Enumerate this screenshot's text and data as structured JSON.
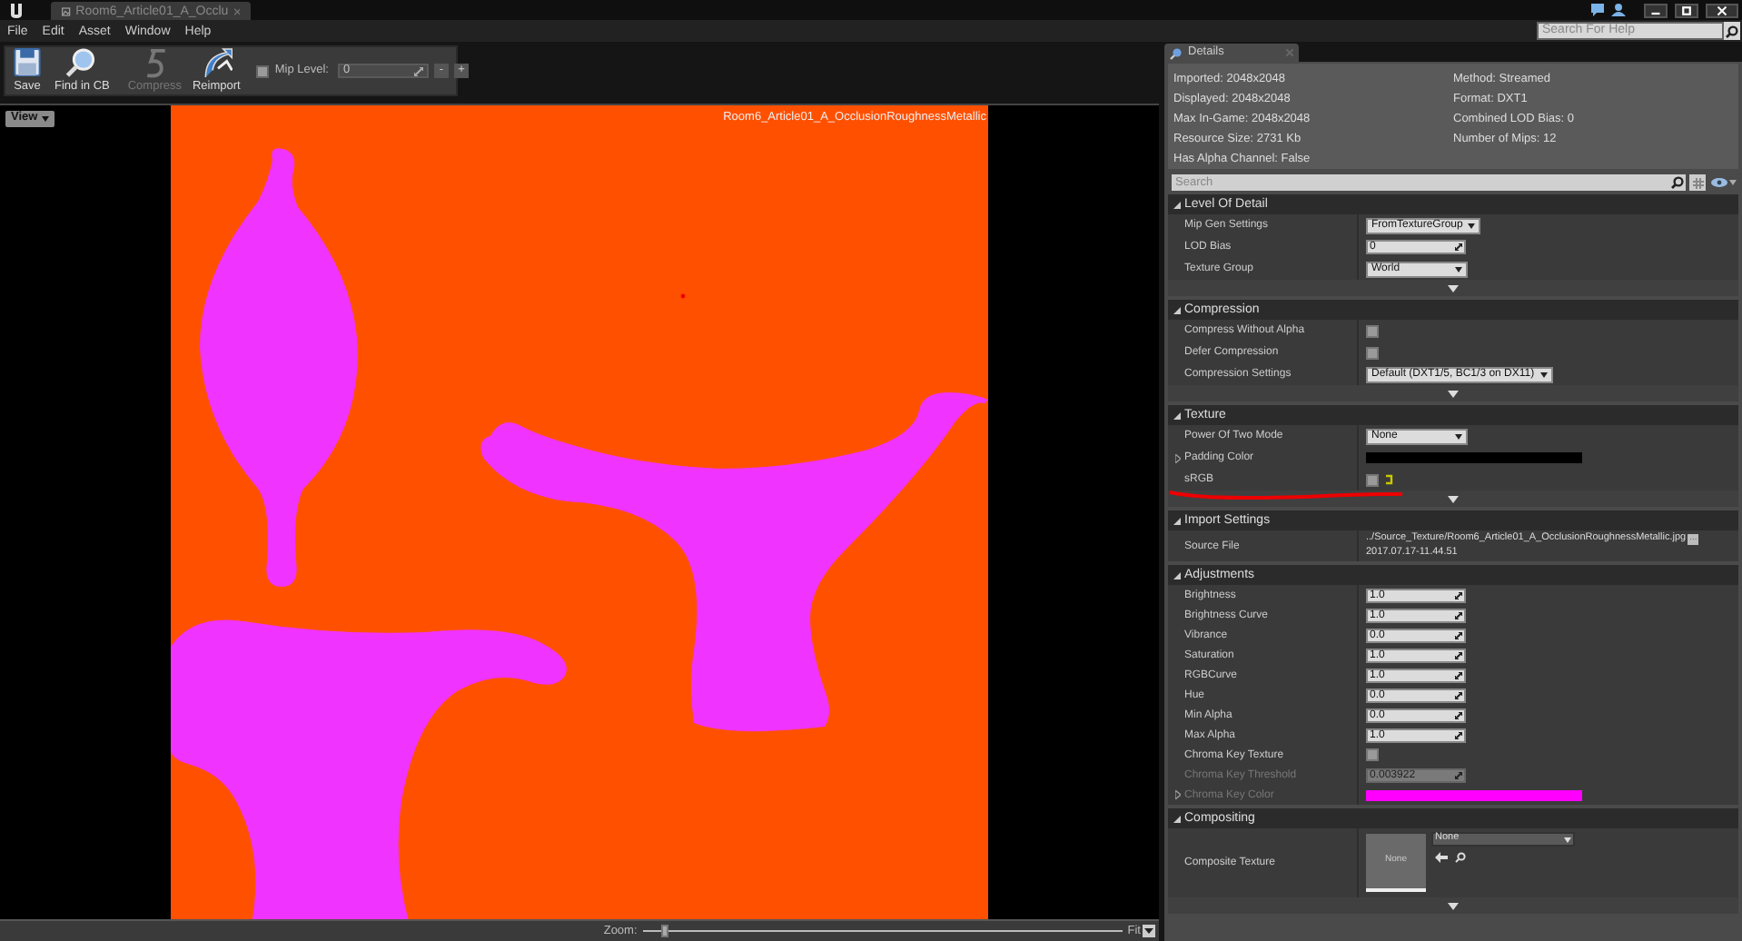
{
  "window": {
    "tab": {
      "title": "Room6_Article01_A_Occlu",
      "selected": true
    }
  },
  "menu": [
    "File",
    "Edit",
    "Asset",
    "Window",
    "Help"
  ],
  "toolbar": {
    "buttons": [
      {
        "label": "Save",
        "kind": "save",
        "disabled": false
      },
      {
        "label": "Find in CB",
        "kind": "find",
        "disabled": false
      },
      {
        "label": "Compress",
        "kind": "compress",
        "disabled": true
      },
      {
        "label": "Reimport",
        "kind": "reimport",
        "disabled": false
      }
    ],
    "mip_level": {
      "label": "Mip Level:",
      "checked": false,
      "value": "0",
      "minus": "-",
      "plus": "+"
    }
  },
  "viewport": {
    "view_button": "View",
    "texture_name": "Room6_Article01_A_OcclusionRoughnessMetallic",
    "zoom": {
      "label": "Zoom:",
      "level": 0.04,
      "fit": "Fit"
    }
  },
  "help_search": {
    "placeholder": "Search For Help"
  },
  "details": {
    "tab": "Details",
    "info_left": [
      "Imported: 2048x2048",
      "Displayed: 2048x2048",
      "Max In-Game: 2048x2048",
      "Resource Size: 2731 Kb",
      "Has Alpha Channel: False"
    ],
    "info_right": [
      "Method: Streamed",
      "Format: DXT1",
      "Combined LOD Bias: 0",
      "Number of Mips: 12"
    ],
    "search": {
      "placeholder": "Search"
    },
    "sections": [
      {
        "title": "Level Of Detail",
        "expanded": true,
        "advanced_toggle": true,
        "rows": [
          {
            "label": "Mip Gen Settings",
            "kind": "dropdown",
            "value": "FromTextureGroup",
            "disabled": false
          },
          {
            "label": "LOD Bias",
            "kind": "number",
            "value": "0",
            "disabled": false
          },
          {
            "label": "Texture Group",
            "kind": "dropdown",
            "value": "World",
            "disabled": false
          }
        ]
      },
      {
        "title": "Compression",
        "expanded": true,
        "advanced_toggle": true,
        "rows": [
          {
            "label": "Compress Without Alpha",
            "kind": "checkbox",
            "checked": false,
            "modified": false,
            "disabled": false
          },
          {
            "label": "Defer Compression",
            "kind": "checkbox",
            "checked": false,
            "modified": false,
            "disabled": false
          },
          {
            "label": "Compression Settings",
            "kind": "dropdown",
            "value": "Default (DXT1/5, BC1/3 on DX11)",
            "disabled": false
          }
        ]
      },
      {
        "title": "Texture",
        "expanded": true,
        "advanced_toggle": true,
        "rows": [
          {
            "label": "Power Of Two Mode",
            "kind": "dropdown",
            "value": "None",
            "disabled": false
          },
          {
            "label": "Padding Color",
            "kind": "color",
            "color": "#000000",
            "disabled": false
          },
          {
            "label": "sRGB",
            "kind": "checkbox",
            "checked": false,
            "modified": true,
            "disabled": false,
            "underlined": true
          }
        ]
      },
      {
        "title": "Import Settings",
        "expanded": true,
        "advanced_toggle": false,
        "rows": [
          {
            "label": "Source File",
            "kind": "file",
            "value": "../Source_Texture/Room6_Article01_A_OcclusionRoughnessMetallic.jpg",
            "date": "2017.07.17-11.44.51",
            "browse": "...",
            "disabled": false
          }
        ]
      },
      {
        "title": "Adjustments",
        "expanded": true,
        "advanced_toggle": false,
        "rows": [
          {
            "label": "Brightness",
            "kind": "number",
            "value": "1.0",
            "disabled": false
          },
          {
            "label": "Brightness Curve",
            "kind": "number",
            "value": "1.0",
            "disabled": false
          },
          {
            "label": "Vibrance",
            "kind": "number",
            "value": "0.0",
            "disabled": false
          },
          {
            "label": "Saturation",
            "kind": "number",
            "value": "1.0",
            "disabled": false
          },
          {
            "label": "RGBCurve",
            "kind": "number",
            "value": "1.0",
            "disabled": false
          },
          {
            "label": "Hue",
            "kind": "number",
            "value": "0.0",
            "disabled": false
          },
          {
            "label": "Min Alpha",
            "kind": "number",
            "value": "0.0",
            "disabled": false
          },
          {
            "label": "Max Alpha",
            "kind": "number",
            "value": "1.0",
            "disabled": false
          },
          {
            "label": "Chroma Key Texture",
            "kind": "checkbox",
            "checked": false,
            "modified": false,
            "disabled": false
          },
          {
            "label": "Chroma Key Threshold",
            "kind": "number",
            "value": "0.003922",
            "disabled": true
          },
          {
            "label": "Chroma Key Color",
            "kind": "color",
            "color": "#ff00ff",
            "disabled": true
          }
        ]
      },
      {
        "title": "Compositing",
        "expanded": true,
        "advanced_toggle": true,
        "rows": [
          {
            "label": "Composite Texture",
            "kind": "texture",
            "thumb": "None",
            "value": "None",
            "disabled": false
          }
        ]
      }
    ]
  }
}
